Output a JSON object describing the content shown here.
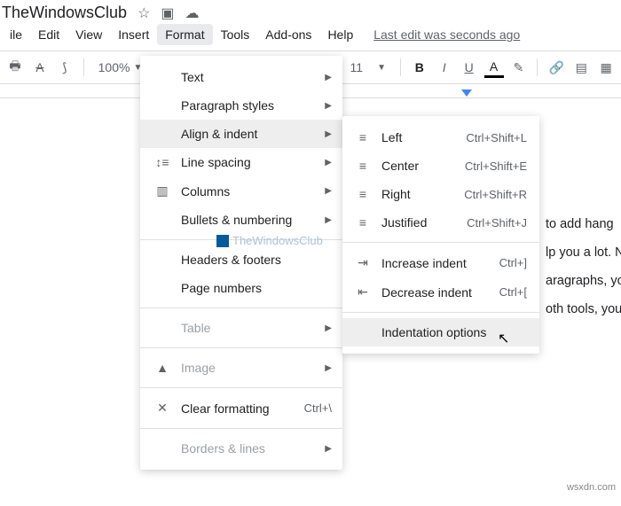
{
  "doc": {
    "title": "TheWindowsClub"
  },
  "menubar": {
    "items": [
      "ile",
      "Edit",
      "View",
      "Insert",
      "Format",
      "Tools",
      "Add-ons",
      "Help"
    ],
    "last_edit": "Last edit was seconds ago"
  },
  "toolbar": {
    "zoom": "100%",
    "fontsize": "11"
  },
  "format_menu": {
    "text": "Text",
    "paragraph_styles": "Paragraph styles",
    "align_indent": "Align & indent",
    "line_spacing": "Line spacing",
    "columns": "Columns",
    "bullets_numbering": "Bullets & numbering",
    "headers_footers": "Headers & footers",
    "page_numbers": "Page numbers",
    "table": "Table",
    "image": "Image",
    "clear_formatting": "Clear formatting",
    "clear_shortcut": "Ctrl+\\",
    "borders_lines": "Borders & lines"
  },
  "align_submenu": {
    "left": "Left",
    "left_sc": "Ctrl+Shift+L",
    "center": "Center",
    "center_sc": "Ctrl+Shift+E",
    "right": "Right",
    "right_sc": "Ctrl+Shift+R",
    "justified": "Justified",
    "justified_sc": "Ctrl+Shift+J",
    "increase": "Increase indent",
    "increase_sc": "Ctrl+]",
    "decrease": "Decrease indent",
    "decrease_sc": "Ctrl+[",
    "options": "Indentation options"
  },
  "doc_body": {
    "l1": "to add hang",
    "l2": "lp you a lot. N",
    "l3": "aragraphs, yo",
    "l4": "oth tools, you"
  },
  "watermark": "TheWindowsClub",
  "attribution": "wsxdn.com"
}
